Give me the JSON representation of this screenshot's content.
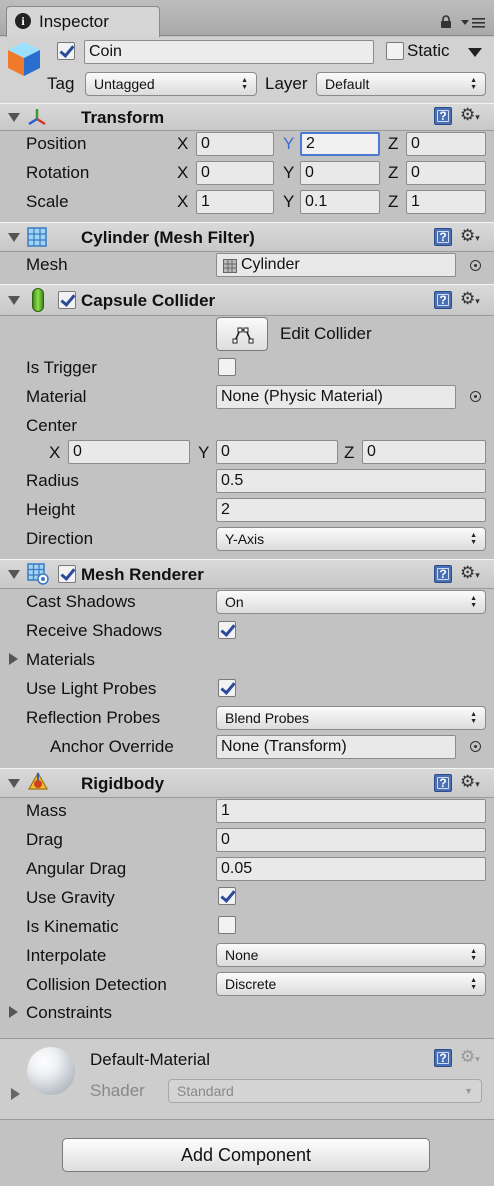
{
  "tab": {
    "title": "Inspector"
  },
  "gameobject": {
    "active": true,
    "name": "Coin",
    "static_label": "Static",
    "static": false,
    "tag_label": "Tag",
    "tag_value": "Untagged",
    "layer_label": "Layer",
    "layer_value": "Default"
  },
  "transform": {
    "title": "Transform",
    "position_label": "Position",
    "rotation_label": "Rotation",
    "scale_label": "Scale",
    "axis_x": "X",
    "axis_y": "Y",
    "axis_z": "Z",
    "position": {
      "x": "0",
      "y": "2",
      "z": "0"
    },
    "rotation": {
      "x": "0",
      "y": "0",
      "z": "0"
    },
    "scale": {
      "x": "1",
      "y": "0.1",
      "z": "1"
    }
  },
  "mesh_filter": {
    "title": "Cylinder (Mesh Filter)",
    "mesh_label": "Mesh",
    "mesh_value": "Cylinder"
  },
  "capsule_collider": {
    "title": "Capsule Collider",
    "enabled": true,
    "edit_label": "Edit Collider",
    "is_trigger_label": "Is Trigger",
    "is_trigger": false,
    "material_label": "Material",
    "material_value": "None (Physic Material)",
    "center_label": "Center",
    "center": {
      "x": "0",
      "y": "0",
      "z": "0"
    },
    "radius_label": "Radius",
    "radius_value": "0.5",
    "height_label": "Height",
    "height_value": "2",
    "direction_label": "Direction",
    "direction_value": "Y-Axis"
  },
  "mesh_renderer": {
    "title": "Mesh Renderer",
    "enabled": true,
    "cast_shadows_label": "Cast Shadows",
    "cast_shadows_value": "On",
    "receive_shadows_label": "Receive Shadows",
    "receive_shadows": true,
    "materials_label": "Materials",
    "use_light_probes_label": "Use Light Probes",
    "use_light_probes": true,
    "reflection_probes_label": "Reflection Probes",
    "reflection_probes_value": "Blend Probes",
    "anchor_override_label": "Anchor Override",
    "anchor_override_value": "None (Transform)"
  },
  "rigidbody": {
    "title": "Rigidbody",
    "mass_label": "Mass",
    "mass_value": "1",
    "drag_label": "Drag",
    "drag_value": "0",
    "angular_drag_label": "Angular Drag",
    "angular_drag_value": "0.05",
    "use_gravity_label": "Use Gravity",
    "use_gravity": true,
    "is_kinematic_label": "Is Kinematic",
    "is_kinematic": false,
    "interpolate_label": "Interpolate",
    "interpolate_value": "None",
    "collision_detection_label": "Collision Detection",
    "collision_detection_value": "Discrete",
    "constraints_label": "Constraints"
  },
  "material": {
    "title": "Default-Material",
    "shader_label": "Shader",
    "shader_value": "Standard"
  },
  "add_component": {
    "label": "Add Component"
  },
  "colors": {
    "panel_bg": "#c2c2c2",
    "focus_blue": "#4a78d6",
    "help_blue": "#4a6fb5"
  }
}
